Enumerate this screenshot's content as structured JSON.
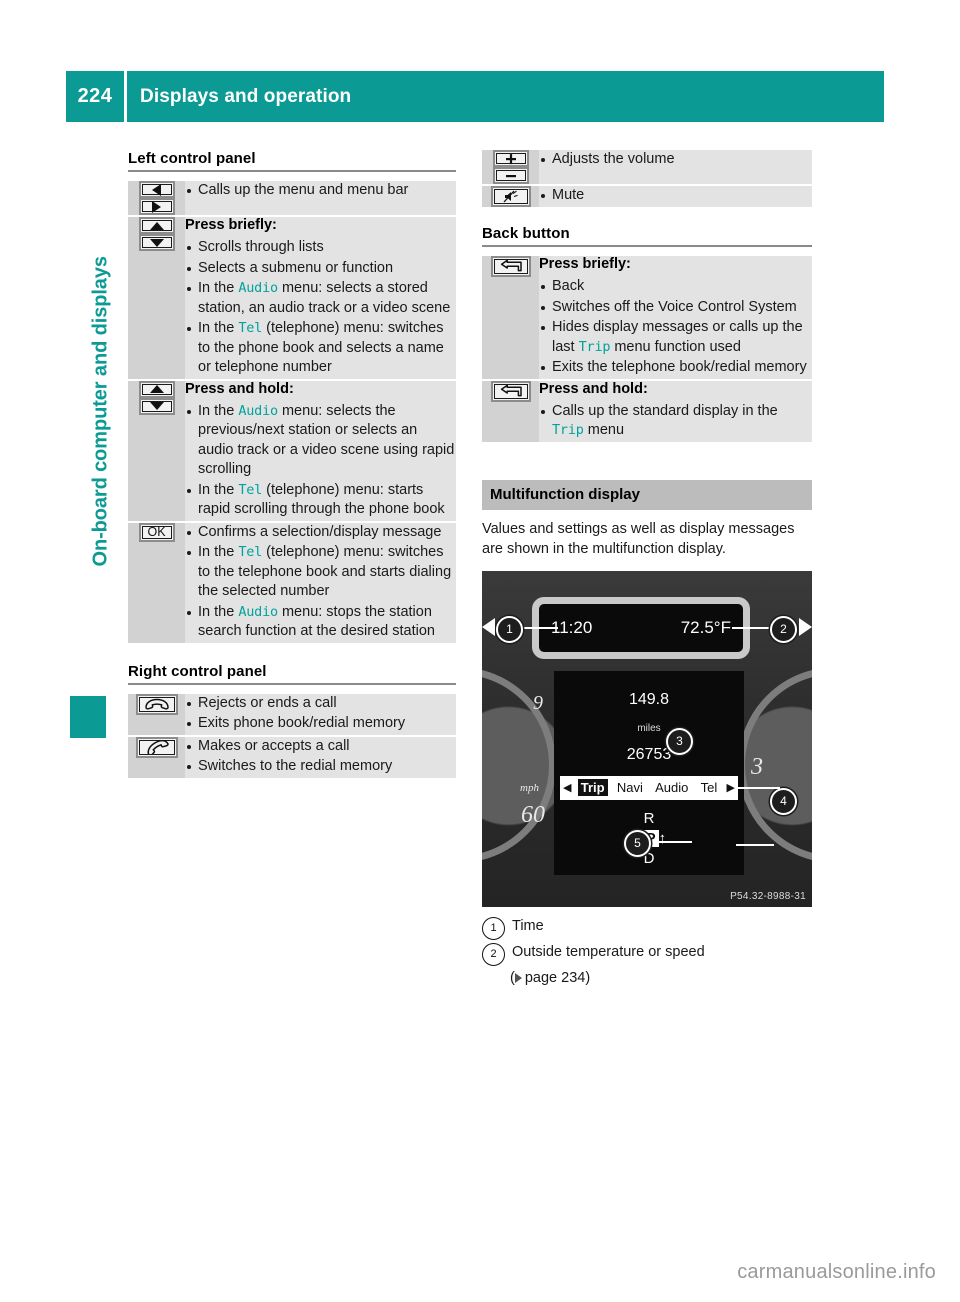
{
  "header": {
    "page_number": "224",
    "title": "Displays and operation"
  },
  "sidebar": {
    "chapter_label": "On-board computer and displays"
  },
  "colors": {
    "accent_teal": "#0b9a94",
    "mono_teal": "#00a39c",
    "row_bg": "#e3e3e3",
    "icon_cell_bg": "#d2d2d2",
    "band_bg": "#bcbcbc"
  },
  "left_column": {
    "section_left_control_panel": {
      "heading": "Left control panel",
      "rows": [
        {
          "icons": [
            "arrow-left-button",
            "arrow-right-button"
          ],
          "lead": "",
          "items": [
            [
              {
                "t": "Calls up the menu and menu bar"
              }
            ]
          ]
        },
        {
          "icons": [
            "arrow-up-button",
            "arrow-down-button"
          ],
          "lead": "Press briefly:",
          "items": [
            [
              {
                "t": "Scrolls through lists"
              }
            ],
            [
              {
                "t": "Selects a submenu or function"
              }
            ],
            [
              {
                "t": "In the "
              },
              {
                "t": "Audio",
                "mono": true
              },
              {
                "t": " menu: selects a stored station, an audio track or a video scene"
              }
            ],
            [
              {
                "t": "In the "
              },
              {
                "t": "Tel",
                "mono": true
              },
              {
                "t": " (telephone) menu: switches to the phone book and selects a name or telephone number"
              }
            ]
          ]
        },
        {
          "icons": [
            "arrow-up-button",
            "arrow-down-button"
          ],
          "lead": "Press and hold:",
          "items": [
            [
              {
                "t": "In the "
              },
              {
                "t": "Audio",
                "mono": true
              },
              {
                "t": " menu: selects the previous/next station or selects an audio track or a video scene using rapid scrolling"
              }
            ],
            [
              {
                "t": "In the "
              },
              {
                "t": "Tel",
                "mono": true
              },
              {
                "t": " (telephone) menu: starts rapid scrolling through the phone book"
              }
            ]
          ]
        },
        {
          "icons": [
            "ok-button"
          ],
          "lead": "",
          "items": [
            [
              {
                "t": "Confirms a selection/display message"
              }
            ],
            [
              {
                "t": "In the "
              },
              {
                "t": "Tel",
                "mono": true
              },
              {
                "t": " (telephone) menu: switches to the telephone book and starts dialing the selected number"
              }
            ],
            [
              {
                "t": "In the "
              },
              {
                "t": "Audio",
                "mono": true
              },
              {
                "t": " menu: stops the station search function at the desired station"
              }
            ]
          ]
        }
      ]
    },
    "section_right_control_panel": {
      "heading": "Right control panel",
      "rows": [
        {
          "icons": [
            "end-call-button"
          ],
          "lead": "",
          "items": [
            [
              {
                "t": "Rejects or ends a call"
              }
            ],
            [
              {
                "t": "Exits phone book/redial memory"
              }
            ]
          ]
        },
        {
          "icons": [
            "accept-call-button"
          ],
          "lead": "",
          "items": [
            [
              {
                "t": "Makes or accepts a call"
              }
            ],
            [
              {
                "t": "Switches to the redial memory"
              }
            ]
          ]
        }
      ]
    }
  },
  "right_column": {
    "volume_rows": [
      {
        "icons": [
          "volume-up-button",
          "volume-down-button"
        ],
        "lead": "",
        "items": [
          [
            {
              "t": "Adjusts the volume"
            }
          ]
        ]
      },
      {
        "icons": [
          "mute-button"
        ],
        "lead": "",
        "items": [
          [
            {
              "t": "Mute"
            }
          ]
        ]
      }
    ],
    "section_back_button": {
      "heading": "Back button",
      "rows": [
        {
          "icons": [
            "back-button"
          ],
          "lead": "Press briefly:",
          "items": [
            [
              {
                "t": "Back"
              }
            ],
            [
              {
                "t": "Switches off the Voice Control System"
              }
            ],
            [
              {
                "t": "Hides display messages or calls up the last "
              },
              {
                "t": "Trip",
                "mono": true
              },
              {
                "t": " menu function used"
              }
            ],
            [
              {
                "t": "Exits the telephone book/redial memory"
              }
            ]
          ]
        },
        {
          "icons": [
            "back-button"
          ],
          "lead": "Press and hold:",
          "items": [
            [
              {
                "t": "Calls up the standard display in the "
              },
              {
                "t": "Trip",
                "mono": true
              },
              {
                "t": " menu"
              }
            ]
          ]
        }
      ]
    },
    "section_multifunction_display": {
      "heading": "Multifunction display",
      "paragraph": "Values and settings as well as display messages are shown in the multifunction display.",
      "figure": {
        "time": "11:20",
        "temperature": "72.5°F",
        "trip_distance": "149.8",
        "unit": "miles",
        "odometer": "26753",
        "menu_bar": [
          "Trip",
          "Navi",
          "Audio",
          "Tel"
        ],
        "menu_selected": "Trip",
        "left_arrow": "◀",
        "right_arrow": "▶",
        "gear_above": "R",
        "gear_current": "N",
        "gear_selected": "P",
        "gear_below": "D",
        "callouts": [
          "1",
          "2",
          "3",
          "4",
          "5"
        ],
        "image_code": "P54.32-8988-31",
        "speedo_unit": "mph",
        "speedo_left_number": "60",
        "speedo_left_number2": "9",
        "speedo_right_number": "3"
      },
      "legend": [
        {
          "num": "1",
          "text": "Time",
          "sub": null
        },
        {
          "num": "2",
          "text": "Outside temperature or speed",
          "sub": "( page 234)",
          "sub_ref": "page 234"
        }
      ]
    }
  },
  "watermark": "carmanualsonline.info"
}
